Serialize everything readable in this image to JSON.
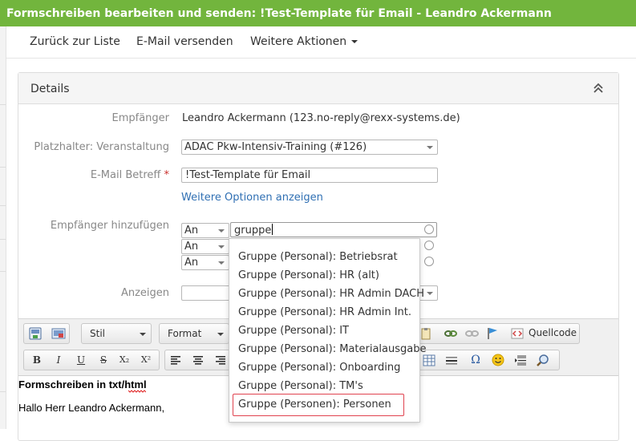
{
  "window": {
    "title": "Formschreiben bearbeiten und senden: !Test-Template für Email - Leandro Ackermann"
  },
  "nav": {
    "back": "Zurück zur Liste",
    "send": "E-Mail versenden",
    "more": "Weitere Aktionen"
  },
  "details": {
    "title": "Details",
    "recipient_label": "Empfänger",
    "recipient_value": "Leandro Ackermann (123.no-reply@rexx-systems.de)",
    "placeholder_label": "Platzhalter: Veranstaltung",
    "placeholder_value": "ADAC Pkw-Intensiv-Training (#126)",
    "subject_label": "E-Mail Betreff",
    "required_mark": "*",
    "subject_value": "!Test-Template für Email",
    "more_options": "Weitere Optionen anzeigen",
    "add_recipients_label": "Empfänger hinzufügen",
    "recipient_rows": [
      {
        "type": "An",
        "value": "gruppe"
      },
      {
        "type": "An",
        "value": ""
      },
      {
        "type": "An",
        "value": ""
      }
    ],
    "show_label": "Anzeigen"
  },
  "toolbar": {
    "style_combo": "Stil",
    "format_combo": "Format",
    "source_label": "Quellcode",
    "bold": "B",
    "italic": "I",
    "underline": "U",
    "strike": "S",
    "subscript": "X₂",
    "superscript": "X²",
    "omega": "Ω"
  },
  "editor": {
    "heading": "Formschreiben in txt/html",
    "greeting": "Hallo Herr Leandro Ackermann,"
  },
  "autocomplete": {
    "items": [
      "Gruppe (Personal): Betriebsrat",
      "Gruppe (Personal): HR (alt)",
      "Gruppe (Personal): HR Admin DACH",
      "Gruppe (Personal): HR Admin Int.",
      "Gruppe (Personal): IT",
      "Gruppe (Personal): Materialausgabe",
      "Gruppe (Personal): Onboarding",
      "Gruppe (Personal): TM's",
      "Gruppe (Personen): Personen"
    ]
  },
  "colors": {
    "titlebar": "#72b53d",
    "link": "#2f6fb3",
    "highlight": "#e0434f"
  }
}
